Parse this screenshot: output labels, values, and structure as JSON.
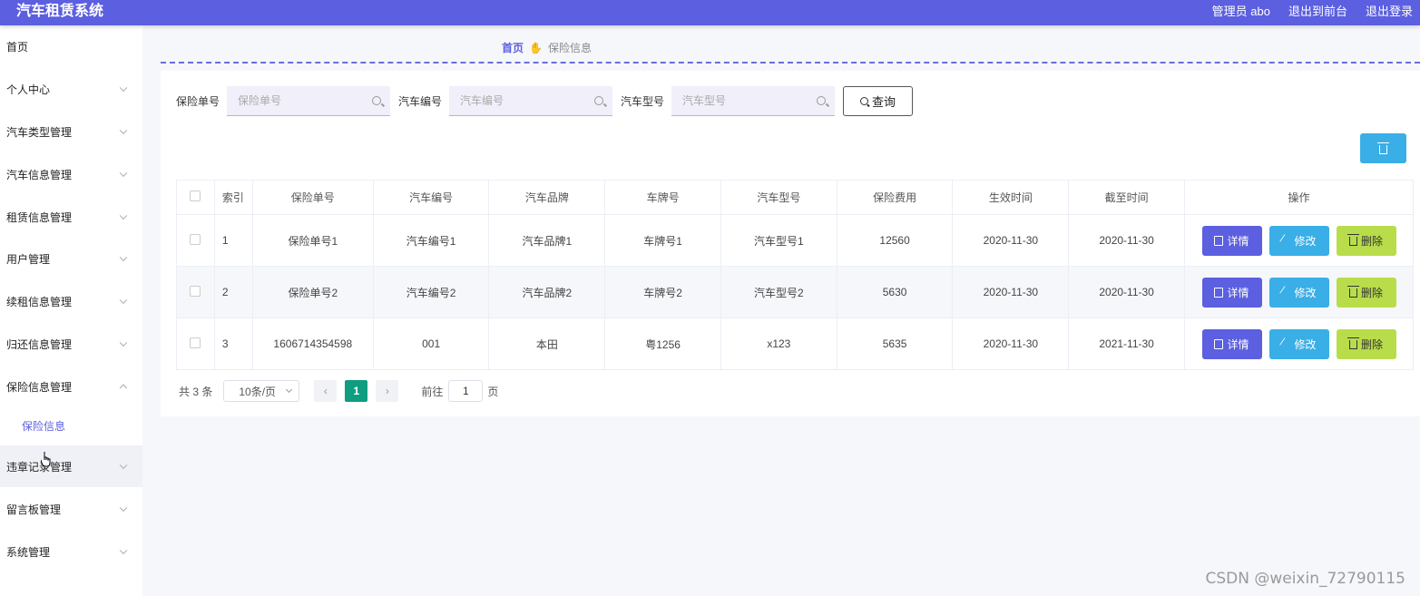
{
  "header": {
    "title": "汽车租赁系统",
    "user": "管理员 abo",
    "to_front": "退出到前台",
    "logout": "退出登录"
  },
  "sidebar": {
    "items": [
      {
        "label": "首页"
      },
      {
        "label": "个人中心"
      },
      {
        "label": "汽车类型管理"
      },
      {
        "label": "汽车信息管理"
      },
      {
        "label": "租赁信息管理"
      },
      {
        "label": "用户管理"
      },
      {
        "label": "续租信息管理"
      },
      {
        "label": "归还信息管理"
      },
      {
        "label": "保险信息管理"
      },
      {
        "label": "违章记录管理"
      },
      {
        "label": "留言板管理"
      },
      {
        "label": "系统管理"
      }
    ],
    "sub_item": "保险信息"
  },
  "breadcrumb": {
    "home": "首页",
    "current": "保险信息"
  },
  "search": {
    "policy_label": "保险单号",
    "policy_placeholder": "保险单号",
    "car_no_label": "汽车编号",
    "car_no_placeholder": "汽车编号",
    "model_label": "汽车型号",
    "model_placeholder": "汽车型号",
    "query_label": "查询"
  },
  "table": {
    "headers": [
      "索引",
      "保险单号",
      "汽车编号",
      "汽车品牌",
      "车牌号",
      "汽车型号",
      "保险费用",
      "生效时间",
      "截至时间",
      "操作"
    ],
    "rows": [
      {
        "index": "1",
        "policy": "保险单号1",
        "car_no": "汽车编号1",
        "brand": "汽车品牌1",
        "plate": "车牌号1",
        "model": "汽车型号1",
        "fee": "12560",
        "start": "2020-11-30",
        "end": "2020-11-30"
      },
      {
        "index": "2",
        "policy": "保险单号2",
        "car_no": "汽车编号2",
        "brand": "汽车品牌2",
        "plate": "车牌号2",
        "model": "汽车型号2",
        "fee": "5630",
        "start": "2020-11-30",
        "end": "2020-11-30"
      },
      {
        "index": "3",
        "policy": "1606714354598",
        "car_no": "001",
        "brand": "本田",
        "plate": "粤1256",
        "model": "x123",
        "fee": "5635",
        "start": "2020-11-30",
        "end": "2021-11-30"
      }
    ],
    "actions": {
      "detail": "详情",
      "edit": "修改",
      "delete": "删除"
    }
  },
  "pager": {
    "total": "共 3 条",
    "page_size": "10条/页",
    "current_page": "1",
    "goto_label": "前往",
    "goto_value": "1",
    "unit": "页"
  },
  "watermark": "CSDN @weixin_72790115",
  "colors": {
    "header": "#5b5fe0",
    "detail_button": "#5b5fe0",
    "edit_button": "#3aaee6",
    "delete_button": "#b9dd4a",
    "active_page": "#0e9d80"
  }
}
